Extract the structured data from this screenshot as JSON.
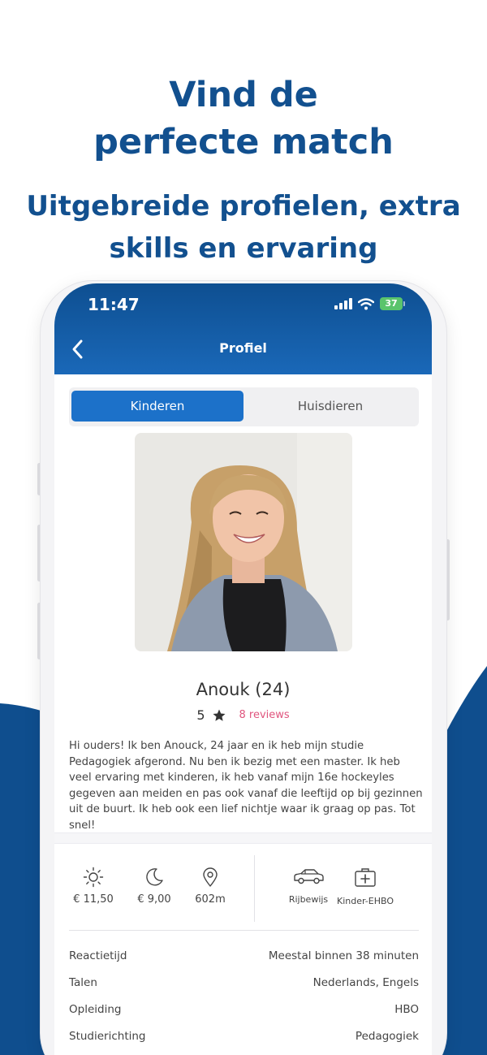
{
  "promo": {
    "headline_line1": "Vind de",
    "headline_line2": "perfecte match",
    "subline_line1": "Uitgebreide profielen, extra",
    "subline_line2": "skills en ervaring"
  },
  "colors": {
    "brand_blue": "#12508f",
    "header_blue": "#1a68b8",
    "segment_active": "#1c71c9",
    "reviews_pink": "#e0557e",
    "battery_green": "#5ac46c"
  },
  "status_bar": {
    "time": "11:47",
    "battery": "37",
    "icons": [
      "signal-icon",
      "wifi-icon",
      "battery-icon"
    ]
  },
  "nav": {
    "title": "Profiel",
    "back_icon": "chevron-left-icon"
  },
  "segments": {
    "active": "Kinderen",
    "inactive": "Huisdieren"
  },
  "profile": {
    "photo_alt": "profile-photo",
    "name": "Anouk (24)",
    "rating": "5",
    "reviews": "8 reviews",
    "bio": "Hi ouders! Ik ben Anouck, 24 jaar en ik heb mijn studie Pedagogiek afgerond. Nu ben ik bezig met een master. Ik heb veel ervaring met kinderen, ik heb vanaf mijn 16e hockeyles gegeven aan meiden en pas ook vanaf die leeftijd op bij gezinnen uit de buurt. Ik heb ook een lief nichtje waar ik graag op pas. Tot snel!"
  },
  "features": {
    "day_rate": "€ 11,50",
    "night_rate": "€ 9,00",
    "distance": "602m",
    "license": "Rijbewijs",
    "first_aid": "Kinder-EHBO"
  },
  "details": [
    {
      "label": "Reactietijd",
      "value": "Meestal binnen 38 minuten"
    },
    {
      "label": "Talen",
      "value": "Nederlands, Engels"
    },
    {
      "label": "Opleiding",
      "value": "HBO"
    },
    {
      "label": "Studierichting",
      "value": "Pedagogiek"
    }
  ]
}
